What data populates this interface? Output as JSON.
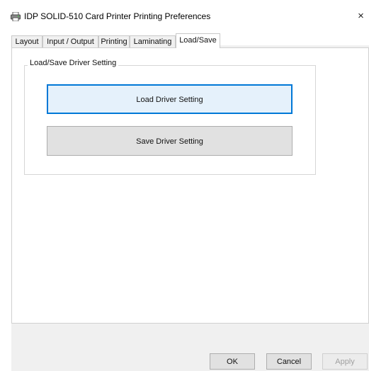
{
  "window": {
    "title": "IDP SOLID-510 Card Printer Printing Preferences",
    "close_glyph": "×",
    "icon": "printer-icon"
  },
  "tabs": [
    {
      "label": "Layout"
    },
    {
      "label": "Input / Output"
    },
    {
      "label": "Printing"
    },
    {
      "label": "Laminating"
    },
    {
      "label": "Load/Save",
      "active": true
    }
  ],
  "group": {
    "label": "Load/Save Driver Setting",
    "load_button": "Load Driver Setting",
    "save_button": "Save Driver Setting"
  },
  "footer": {
    "ok": "OK",
    "cancel": "Cancel",
    "apply": "Apply"
  },
  "colors": {
    "focus_border": "#0078d7",
    "dialog_bg": "#f0f0f0"
  }
}
